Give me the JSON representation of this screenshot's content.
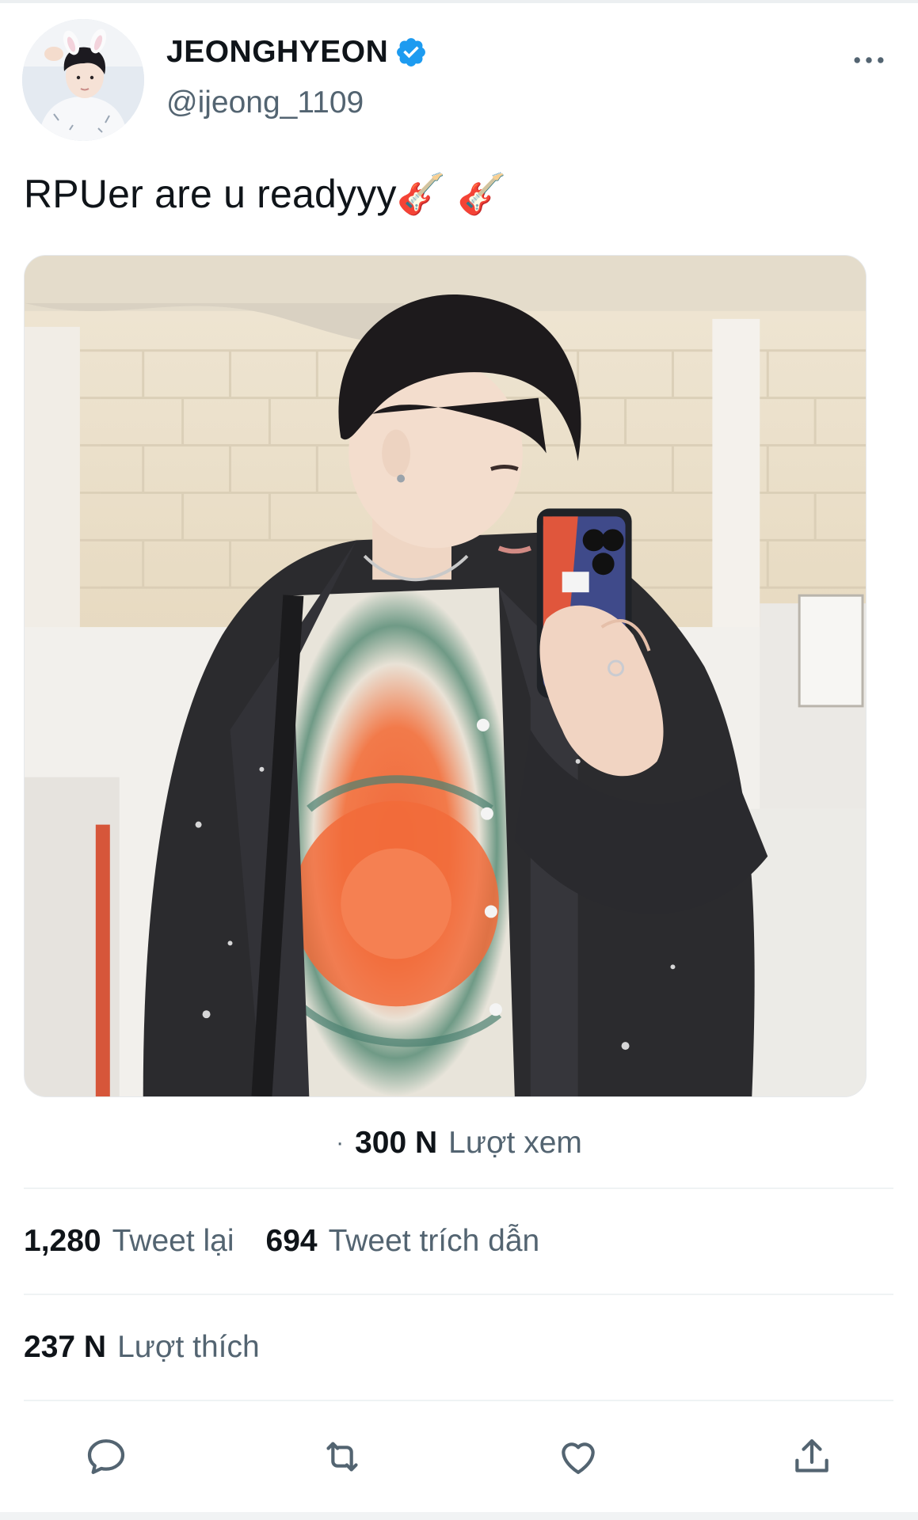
{
  "tweet": {
    "author": {
      "display_name": "JEONGHYEON",
      "handle": "@ijeong_1109",
      "verified": true,
      "avatar_icon": "profile-photo"
    },
    "text": "RPUer are u readyyy🎸 🎸",
    "media": {
      "type": "photo",
      "description_icon": "mirror-selfie-photo"
    },
    "views": {
      "count": "300 N",
      "label": "Lượt xem",
      "separator": "·"
    },
    "retweets": {
      "count": "1,280",
      "label": "Tweet lại"
    },
    "quotes": {
      "count": "694",
      "label": "Tweet trích dẫn"
    },
    "likes": {
      "count": "237 N",
      "label": "Lượt thích"
    }
  },
  "actions": [
    "reply-icon",
    "retweet-icon",
    "like-icon",
    "share-icon"
  ],
  "colors": {
    "text_primary": "#0f1419",
    "text_secondary": "#536471",
    "verified_blue": "#1d9bf0",
    "divider": "#eff3f4"
  }
}
